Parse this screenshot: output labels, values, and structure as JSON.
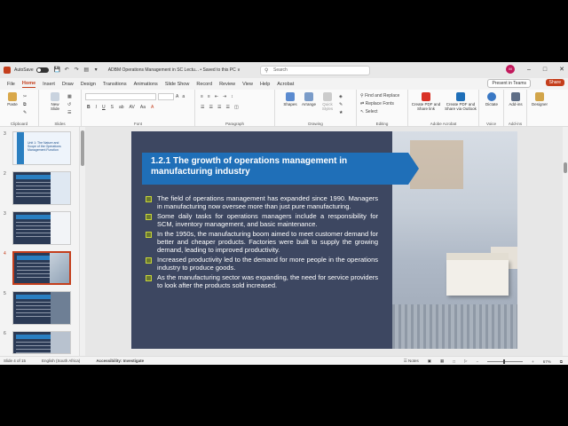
{
  "titlebar": {
    "autosave": "AutoSave",
    "doc_title": "ADBM Operations Management in SC Lectu...  •  Saved to this PC ∨",
    "search_placeholder": "Search",
    "avatar_initials": "M"
  },
  "menu": {
    "tabs": [
      "File",
      "Home",
      "Insert",
      "Draw",
      "Design",
      "Transitions",
      "Animations",
      "Slide Show",
      "Record",
      "Review",
      "View",
      "Help",
      "Acrobat"
    ],
    "active_tab": "Home",
    "present_label": "Present in Teams",
    "share_label": "Share"
  },
  "ribbon": {
    "paste": "Paste",
    "clipboard": "Clipboard",
    "new_slide": "New Slide",
    "slides": "Slides",
    "font": "Font",
    "paragraph": "Paragraph",
    "shapes": "Shapes",
    "arrange": "Arrange",
    "quick_styles": "Quick Styles",
    "drawing": "Drawing",
    "find_replace": "Find and Replace",
    "replace_fonts": "Replace Fonts",
    "select": "Select",
    "editing": "Editing",
    "create_pdf_share": "Create PDF and Share link",
    "create_pdf_outlook": "Create PDF and Share via Outlook",
    "adobe_acrobat": "Adobe Acrobat",
    "dictate": "Dictate",
    "voice": "Voice",
    "addins": "Add-ins",
    "addins_group": "Add-ins",
    "designer": "Designer"
  },
  "thumbnails": [
    {
      "num": "3",
      "title": "Unit 1: The Nature and Scope of the Operations Management Function"
    },
    {
      "num": "2",
      "title": ""
    },
    {
      "num": "3",
      "title": ""
    },
    {
      "num": "4",
      "title": ""
    },
    {
      "num": "5",
      "title": ""
    },
    {
      "num": "6",
      "title": ""
    }
  ],
  "slide": {
    "title": "1.2.1 The growth of operations management in manufacturing industry",
    "bullets": [
      "The field of operations management has expanded since 1990. Managers in manufacturing now oversee more than just pure manufacturing.",
      "Some daily tasks for operations managers include a responsibility for SCM, inventory management, and basic maintenance.",
      "In the 1950s, the manufacturing boom aimed to meet customer demand for better and cheaper products. Factories were built to supply the growing demand, leading to improved productivity.",
      "Increased productivity led to the demand for more people in the operations industry to produce goods.",
      "As the manufacturing sector was expanding, the need for service providers to look after the products sold increased."
    ]
  },
  "status": {
    "slide_counter": "Slide 4 of 15",
    "language": "English (South Africa)",
    "accessibility": "Accessibility: Investigate",
    "notes": "Notes",
    "zoom": "67%"
  },
  "colors": {
    "accent": "#c43e1c",
    "slide_bg": "#3d4761",
    "banner": "#1f6fb8",
    "bullet": "#c9d63a"
  }
}
